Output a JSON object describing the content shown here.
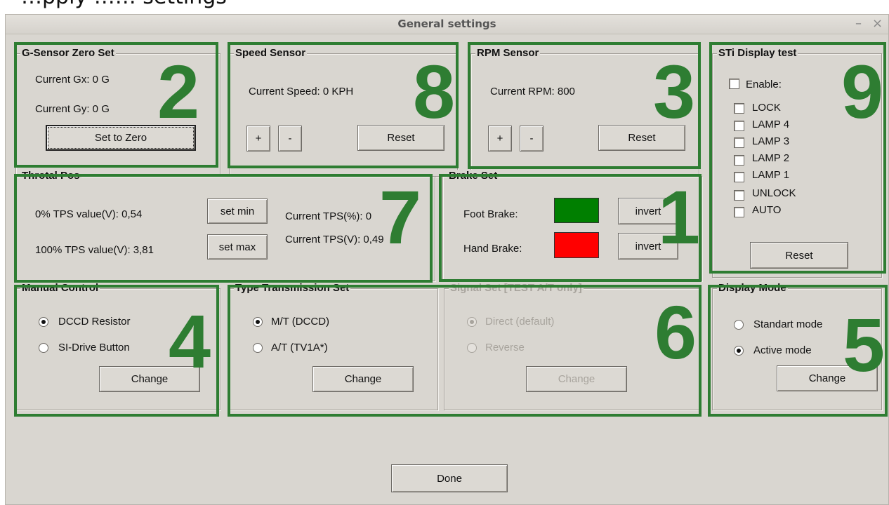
{
  "background_title": "…pply …… settings",
  "window": {
    "title": "General settings",
    "minimize_glyph": "–",
    "close_glyph": "×"
  },
  "gsensor": {
    "title": "G-Sensor Zero Set",
    "gx": "Current Gx:  0 G",
    "gy": "Current Gy:  0 G",
    "zero_button": "Set to Zero"
  },
  "speed": {
    "title": "Speed Sensor",
    "current": "Current Speed:  0 KPH",
    "plus": "+",
    "minus": "-",
    "reset": "Reset"
  },
  "rpm": {
    "title": "RPM Sensor",
    "current": "Current RPM:  800",
    "plus": "+",
    "minus": "-",
    "reset": "Reset"
  },
  "sti": {
    "title": "STi Display test",
    "enable": "Enable:",
    "lamps": [
      "LOCK",
      "LAMP 4",
      "LAMP 3",
      "LAMP 2",
      "LAMP 1",
      "UNLOCK",
      "AUTO"
    ],
    "reset": "Reset"
  },
  "throttle": {
    "title": "Throtal Pos",
    "tps0": "0% TPS value(V):  0,54",
    "tps100": "100% TPS value(V):  3,81",
    "set_min": "set min",
    "set_max": "set max",
    "current_pct": "Current TPS(%):  0",
    "current_v": "Current TPS(V):  0,49"
  },
  "brake": {
    "title": "Brake Set",
    "foot": "Foot Brake:",
    "hand": "Hand Brake:",
    "invert": "invert",
    "foot_color": "#007f00",
    "hand_color": "#ff0000"
  },
  "manual": {
    "title": "Manual Control",
    "options": [
      "DCCD Resistor",
      "SI-Drive Button"
    ],
    "selected": "DCCD Resistor",
    "change": "Change"
  },
  "transmission": {
    "title": "Type Transmission Set",
    "options": [
      "M/T (DCCD)",
      "A/T (TV1A*)"
    ],
    "selected": "M/T (DCCD)",
    "change": "Change"
  },
  "signal": {
    "title": "Signal Set [TEST A/T only]",
    "options": [
      "Direct (default)",
      "Reverse"
    ],
    "selected": "Direct (default)",
    "change": "Change"
  },
  "display": {
    "title": "Display Mode",
    "options": [
      "Standart mode",
      "Active mode"
    ],
    "selected": "Active mode",
    "change": "Change"
  },
  "done": "Done",
  "annotations": [
    "2",
    "8",
    "3",
    "9",
    "7",
    "1",
    "4",
    "6",
    "5"
  ],
  "annotation_color": "#2e7d32"
}
